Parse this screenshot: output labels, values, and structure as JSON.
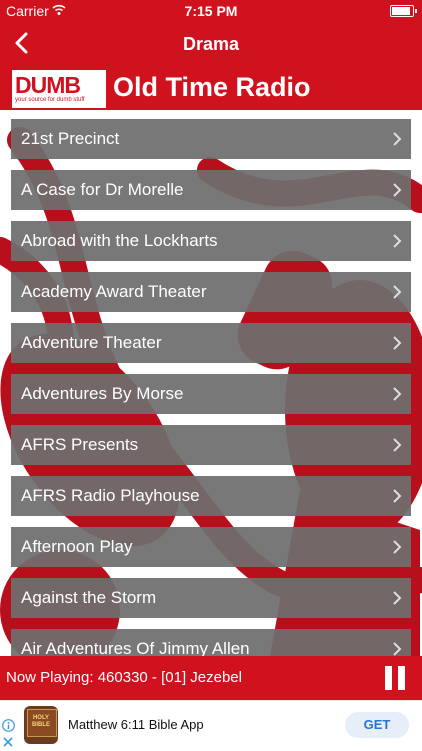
{
  "status_bar": {
    "carrier": "Carrier",
    "time": "7:15 PM",
    "battery_level": 0.92
  },
  "nav": {
    "title": "Drama",
    "back_icon": "chevron-left-icon"
  },
  "brand": {
    "logo_text": "DUMB",
    "logo_sub": "your source for dumb stuff",
    "title": "Old Time Radio"
  },
  "list": {
    "items": [
      {
        "label": "21st Precinct"
      },
      {
        "label": "A Case for Dr Morelle"
      },
      {
        "label": "Abroad with the Lockharts"
      },
      {
        "label": "Academy Award Theater"
      },
      {
        "label": "Adventure Theater"
      },
      {
        "label": "Adventures By Morse"
      },
      {
        "label": "AFRS Presents"
      },
      {
        "label": "AFRS Radio Playhouse"
      },
      {
        "label": "Afternoon Play"
      },
      {
        "label": "Against the Storm"
      },
      {
        "label": "Air Adventures Of Jimmy Allen"
      }
    ]
  },
  "now_playing": {
    "text": "Now Playing: 460330 - [01] Jezebel",
    "control_icon": "pause-icon"
  },
  "ad": {
    "app_icon_text": "HOLY BIBLE",
    "title": "Matthew 6:11 Bible App",
    "get_label": "GET"
  },
  "colors": {
    "brand_red": "#d0121f",
    "row_gray": "#6e6e6e",
    "get_blue": "#2a73d8"
  }
}
